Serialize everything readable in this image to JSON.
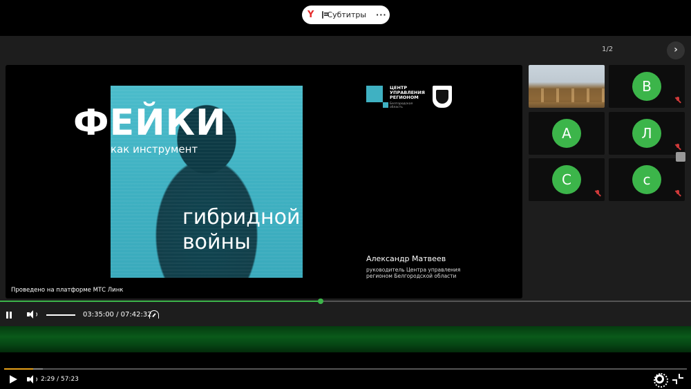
{
  "top_pill": {
    "logo": "Y",
    "subtitles_label": "Субтитры",
    "more_label": "···"
  },
  "conference": {
    "page_counter": "1/2",
    "next_label": "›"
  },
  "slide": {
    "title": "ФЕЙКИ",
    "subtitle_line1": "как инструмент",
    "subtitle_line2": "гибридной",
    "subtitle_line3": "войны",
    "org_name_line1": "ЦЕНТР",
    "org_name_line2": "УПРАВЛЕНИЯ",
    "org_name_line3": "РЕГИОНОМ",
    "org_region_line1": "Белгородская",
    "org_region_line2": "область",
    "speaker_name": "Александр Матвеев",
    "speaker_role_line1": "руководитель Центра управления",
    "speaker_role_line2": "регионом Белгородской области",
    "platform_note": "Проведено на платформе МТС Линк"
  },
  "participants": [
    {
      "initial": "",
      "type": "video"
    },
    {
      "initial": "В",
      "muted": true
    },
    {
      "initial": "А",
      "muted": false
    },
    {
      "initial": "Л",
      "muted": true
    },
    {
      "initial": "С",
      "muted": true
    },
    {
      "initial": "с",
      "muted": true
    }
  ],
  "inner_player": {
    "time": "03:35:00 / 07:42:32",
    "progress": 0.464
  },
  "outer_player": {
    "time": "2:29 / 57:23",
    "progress": 0.043
  },
  "colors": {
    "accent_green": "#3cb54a",
    "slide_teal": "#3fb1c2",
    "progress_orange": "#e8a21a"
  }
}
